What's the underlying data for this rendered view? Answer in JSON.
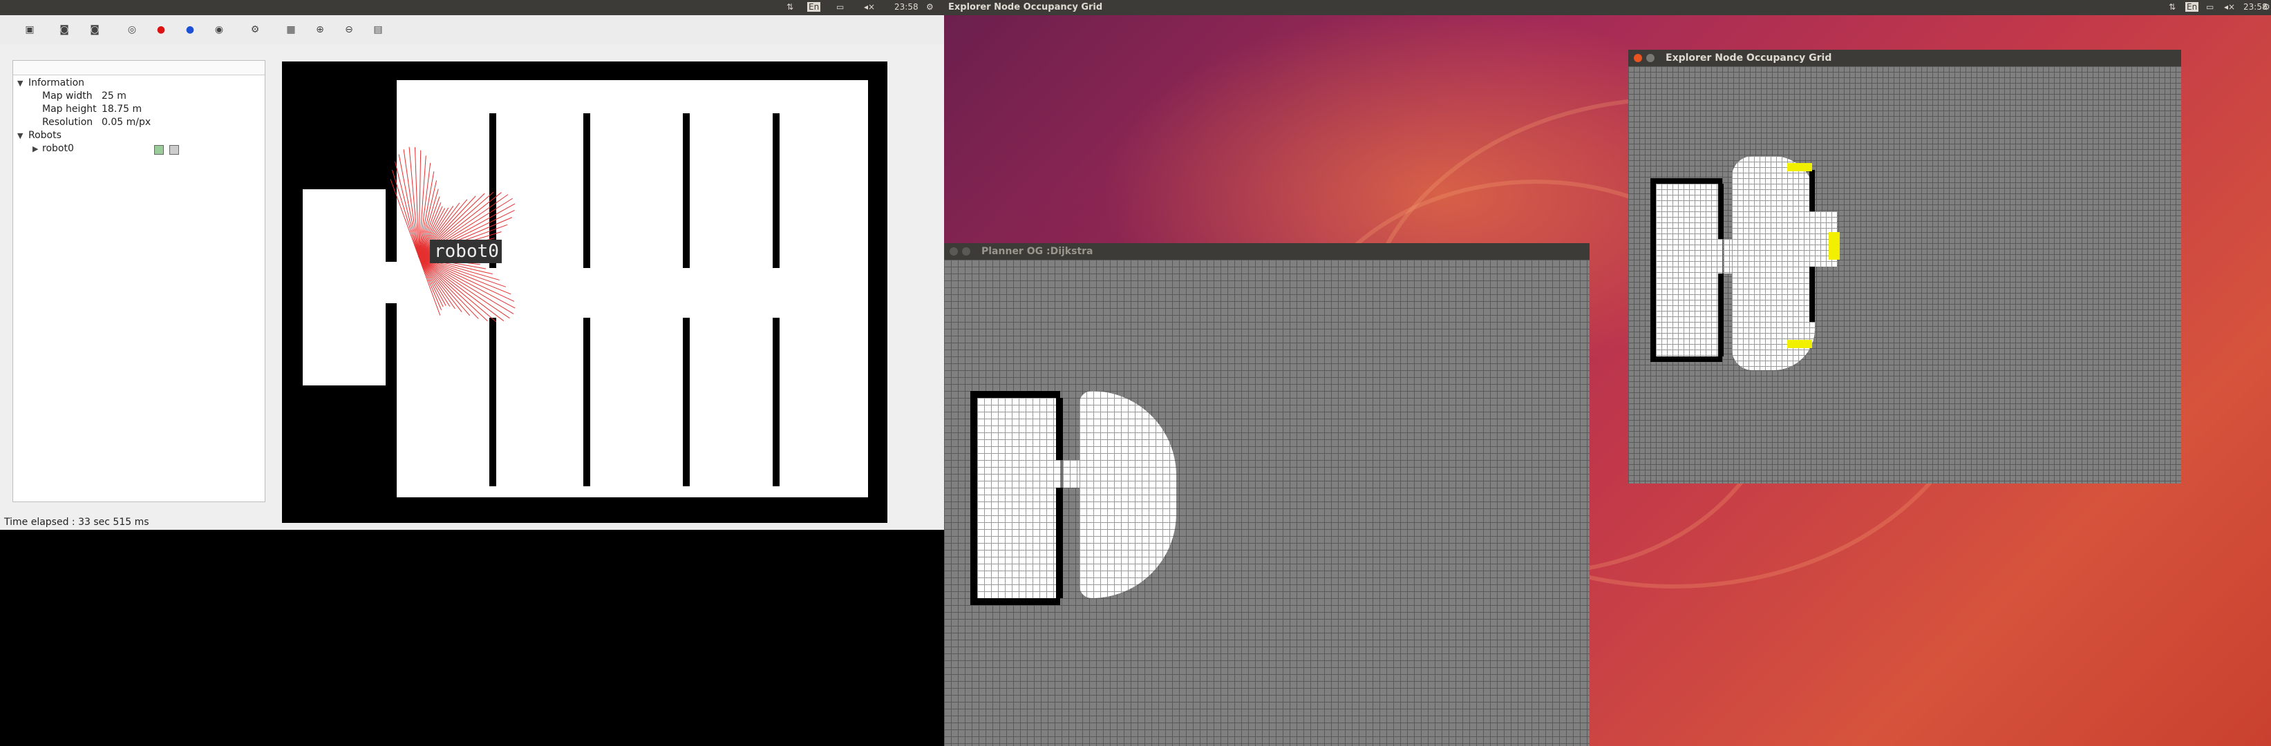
{
  "desktop": {
    "app_title": "Explorer Node Occupancy Grid",
    "clock": "23:58",
    "lang": "En"
  },
  "stage": {
    "toolbar_icons": [
      "save-map-icon",
      "robot-icon",
      "robot-add-icon",
      "trail-icon",
      "record-icon",
      "blue-dot-icon",
      "fiducial-icon",
      "gear-icon",
      "grid-icon",
      "zoom-in-icon",
      "zoom-out-icon",
      "fit-icon"
    ],
    "tree": {
      "information": "Information",
      "map_width_label": "Map width",
      "map_width_value": "25 m",
      "map_height_label": "Map height",
      "map_height_value": "18.75 m",
      "resolution_label": "Resolution",
      "resolution_value": "0.05 m/px",
      "robots": "Robots",
      "robot0": "robot0"
    },
    "robot_label": "robot0",
    "status": "Time elapsed : 33 sec 515 ms"
  },
  "planner_window": {
    "title": "Planner OG :Dijkstra"
  },
  "explorer_window": {
    "title": "Explorer Node Occupancy Grid"
  }
}
